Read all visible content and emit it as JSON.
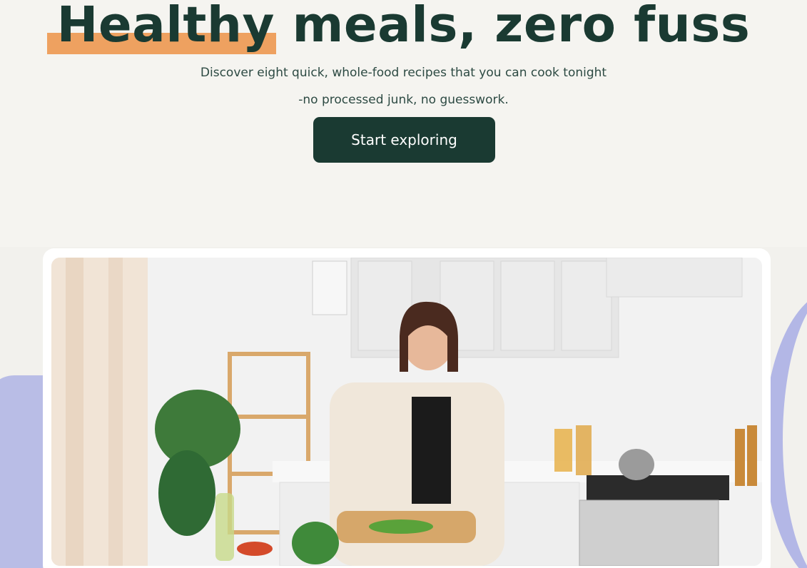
{
  "hero": {
    "title_highlight": "Healthy",
    "title_rest": " meals, zero fuss",
    "subtitle_line1": "Discover eight quick, whole-food recipes that you can cook tonight",
    "subtitle_line2": "-no processed junk, no guesswork.",
    "cta_label": "Start exploring"
  },
  "colors": {
    "brand_dark": "#1a3a32",
    "highlight_orange": "#eea160",
    "lavender": "#b3b7e6",
    "background": "#f5f4f0"
  },
  "image": {
    "subject": "kitchen-photo"
  }
}
